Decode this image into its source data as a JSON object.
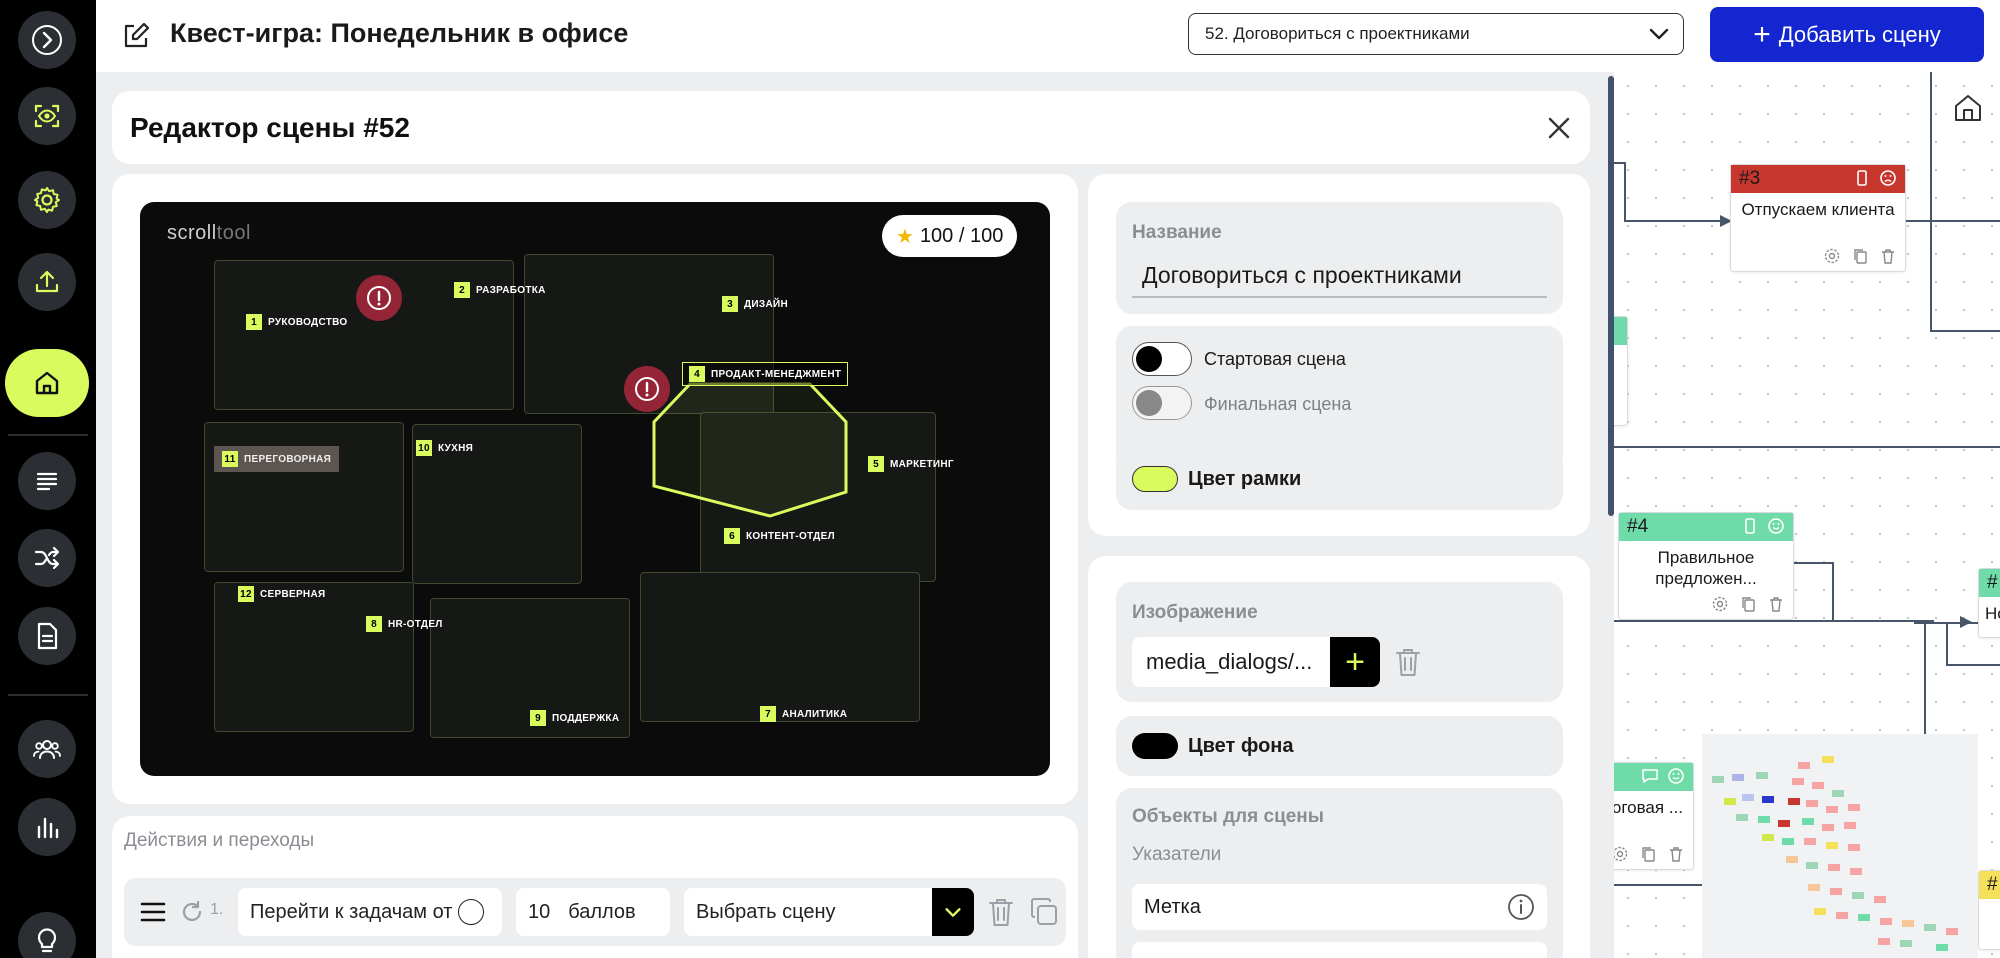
{
  "header": {
    "title": "Квест-игра: Понедельник в офисе",
    "scene_select": "52. Договориться с проектниками",
    "add_scene_label": "Добавить сцену"
  },
  "sidebar": {
    "items": [
      {
        "icon": "chevron-right-icon"
      },
      {
        "icon": "scan-eye-icon"
      },
      {
        "icon": "gear-icon"
      },
      {
        "icon": "upload-icon"
      },
      {
        "icon": "home-icon",
        "active": true
      },
      {
        "icon": "text-lines-icon"
      },
      {
        "icon": "shuffle-icon"
      },
      {
        "icon": "document-icon"
      },
      {
        "icon": "users-icon"
      },
      {
        "icon": "bar-chart-icon"
      },
      {
        "icon": "lightbulb-icon"
      }
    ]
  },
  "editor": {
    "title": "Редактор сцены #52",
    "image": {
      "logo_main": "scroll",
      "logo_sub": "tool",
      "score": "100 / 100",
      "rooms": [
        {
          "num": "1",
          "label": "РУКОВОДСТВО"
        },
        {
          "num": "2",
          "label": "РАЗРАБОТКА"
        },
        {
          "num": "3",
          "label": "ДИЗАЙН"
        },
        {
          "num": "4",
          "label": "ПРОДАКТ-МЕНЕДЖМЕНТ"
        },
        {
          "num": "5",
          "label": "МАРКЕТИНГ"
        },
        {
          "num": "6",
          "label": "КОНТЕНТ-ОТДЕЛ"
        },
        {
          "num": "7",
          "label": "АНАЛИТИКА"
        },
        {
          "num": "8",
          "label": "HR-ОТДЕЛ"
        },
        {
          "num": "9",
          "label": "ПОДДЕРЖКА"
        },
        {
          "num": "10",
          "label": "КУХНЯ"
        },
        {
          "num": "11",
          "label": "ПЕРЕГОВОРНАЯ"
        },
        {
          "num": "12",
          "label": "СЕРВЕРНАЯ"
        }
      ]
    },
    "actions": {
      "section_label": "Действия и переходы",
      "rows": [
        {
          "index": "1.",
          "text": "Перейти к задачам от",
          "points_value": "10",
          "points_unit": "баллов",
          "scene": "Выбрать сцену"
        }
      ]
    },
    "props": {
      "name_label": "Название",
      "name_value": "Договориться с проектниками",
      "start_scene_label": "Стартовая сцена",
      "final_scene_label": "Финальная сцена",
      "frame_color_label": "Цвет рамки",
      "frame_color": "#d9fb5e",
      "image_label": "Изображение",
      "image_value": "media_dialogs/...",
      "bg_color_label": "Цвет фона",
      "bg_color": "#000000",
      "objects_label": "Объекты для сцены",
      "pointers_label": "Указатели",
      "pointer_item": "Метка"
    }
  },
  "canvas": {
    "nodes": [
      {
        "id": "#3",
        "title": "Отпускаем клиента",
        "color": "#c8372d"
      },
      {
        "id": "#4",
        "title": "Правильное предложен...",
        "color": "#6fdba8"
      },
      {
        "id": "",
        "title": "...алоговая ...",
        "color": "#6fdba8"
      },
      {
        "id": "#",
        "title": "Но",
        "color": "#6fdba8"
      },
      {
        "id": "#",
        "title": "",
        "color": "#f5e05a"
      }
    ]
  },
  "colors": {
    "accent": "#d9fb5e",
    "primary_button": "#1326cf",
    "edge": "#475569"
  }
}
